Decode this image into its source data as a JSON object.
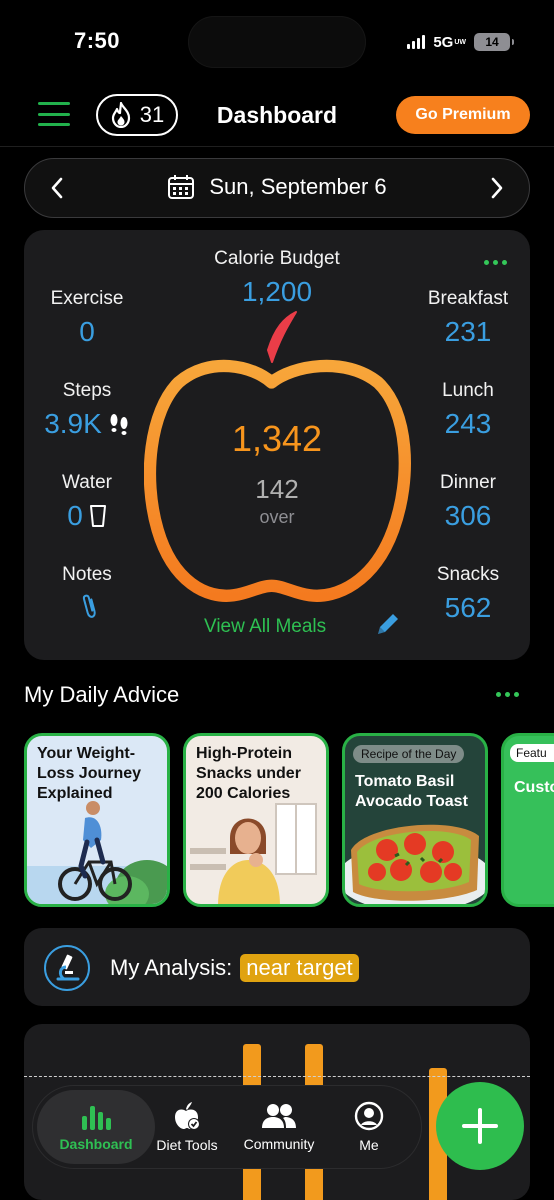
{
  "status": {
    "time": "7:50",
    "network": "5G",
    "network_sub": "UW",
    "battery": "14"
  },
  "header": {
    "streak_count": "31",
    "title": "Dashboard",
    "premium_label": "Go Premium"
  },
  "date_nav": {
    "date": "Sun, September 6"
  },
  "calorie_card": {
    "budget_label": "Calorie Budget",
    "budget_value": "1,200",
    "total": "1,342",
    "over_value": "142",
    "over_label": "over",
    "view_all_label": "View All Meals",
    "left_stats": [
      {
        "label": "Exercise",
        "value": "0"
      },
      {
        "label": "Steps",
        "value": "3.9K"
      },
      {
        "label": "Water",
        "value": "0"
      },
      {
        "label": "Notes",
        "value": ""
      }
    ],
    "right_stats": [
      {
        "label": "Breakfast",
        "value": "231"
      },
      {
        "label": "Lunch",
        "value": "243"
      },
      {
        "label": "Dinner",
        "value": "306"
      },
      {
        "label": "Snacks",
        "value": "562"
      }
    ]
  },
  "advice": {
    "title": "My Daily Advice",
    "cards": [
      {
        "title": "Your Weight-Loss Journey Explained"
      },
      {
        "title": "High-Protein Snacks under 200 Calories"
      },
      {
        "tag": "Recipe of the Day",
        "title": "Tomato Basil Avocado Toast"
      },
      {
        "tag": "Featu",
        "title": "Custo Type"
      }
    ]
  },
  "analysis": {
    "label": "My Analysis:",
    "badge": "near target"
  },
  "tabs": [
    {
      "label": "Dashboard",
      "icon": "bar-chart-icon"
    },
    {
      "label": "Diet Tools",
      "icon": "apple-check-icon"
    },
    {
      "label": "Community",
      "icon": "people-icon"
    },
    {
      "label": "Me",
      "icon": "person-icon"
    }
  ],
  "colors": {
    "accent_green": "#2ebd4e",
    "premium_orange": "#f7801d",
    "value_blue": "#3a9ee0",
    "total_orange": "#f7951d"
  }
}
